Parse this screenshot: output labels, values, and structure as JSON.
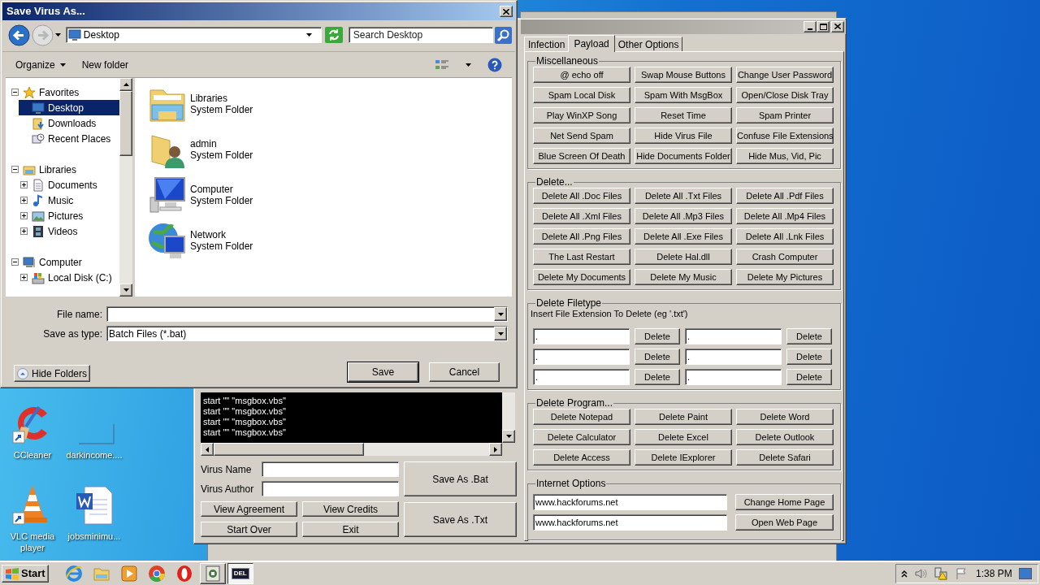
{
  "dialog": {
    "title": "Save Virus As...",
    "address": "Desktop",
    "search_placeholder": "Search Desktop",
    "organize": "Organize",
    "new_folder": "New folder",
    "nav": [
      {
        "label": "Favorites",
        "expanded": true,
        "selected": false,
        "children": [
          {
            "label": "Desktop",
            "selected": true
          },
          {
            "label": "Downloads",
            "selected": false
          },
          {
            "label": "Recent Places",
            "selected": false
          }
        ]
      },
      {
        "label": "Libraries",
        "expanded": true,
        "selected": false,
        "children": [
          {
            "label": "Documents",
            "expanded": false,
            "selected": false
          },
          {
            "label": "Music",
            "expanded": false,
            "selected": false
          },
          {
            "label": "Pictures",
            "expanded": false,
            "selected": false
          },
          {
            "label": "Videos",
            "expanded": false,
            "selected": false
          }
        ]
      },
      {
        "label": "Computer",
        "expanded": true,
        "selected": false,
        "children": [
          {
            "label": "Local Disk (C:)",
            "expanded": false,
            "selected": false
          }
        ]
      }
    ],
    "items": [
      {
        "name": "Libraries",
        "type": "System Folder"
      },
      {
        "name": "admin",
        "type": "System Folder"
      },
      {
        "name": "Computer",
        "type": "System Folder"
      },
      {
        "name": "Network",
        "type": "System Folder"
      }
    ],
    "file_name_label": "File name:",
    "save_type_label": "Save as type:",
    "save_type": "Batch Files (*.bat)",
    "hide_folders": "Hide Folders",
    "save": "Save",
    "cancel": "Cancel"
  },
  "app": {
    "tabs": [
      {
        "label": "Infection",
        "selected": false
      },
      {
        "label": "Payload",
        "selected": true
      },
      {
        "label": "Other Options",
        "selected": false
      }
    ],
    "sections": [
      {
        "kind": "buttons",
        "title": "Miscellaneous",
        "buttons": [
          "@ echo off",
          "Swap Mouse Buttons",
          "Change User Password",
          "Spam Local Disk",
          "Spam With MsgBox",
          "Open/Close Disk Tray",
          "Play WinXP Song",
          "Reset Time",
          "Spam Printer",
          "Net Send Spam",
          "Hide Virus File",
          "Confuse File Extensions",
          "Blue Screen Of Death",
          "Hide Documents Folder",
          "Hide Mus, Vid, Pic"
        ]
      },
      {
        "kind": "buttons",
        "title": "Delete...",
        "buttons": [
          "Delete All .Doc Files",
          "Delete All .Txt Files",
          "Delete All .Pdf Files",
          "Delete All .Xml Files",
          "Delete All .Mp3 Files",
          "Delete All .Mp4 Files",
          "Delete All .Png Files",
          "Delete All .Exe Files",
          "Delete All .Lnk Files",
          "The Last Restart",
          "Delete Hal.dll",
          "Crash Computer",
          "Delete My Documents",
          "Delete My Music",
          "Delete My Pictures"
        ]
      },
      {
        "kind": "filetype",
        "title": "Delete Filetype",
        "hint": "Insert File Extension To Delete (eg '.txt')",
        "rows": [
          {
            "value": ".",
            "button": "Delete"
          },
          {
            "value": ".",
            "button": "Delete"
          },
          {
            "value": ".",
            "button": "Delete"
          },
          {
            "value": ".",
            "button": "Delete"
          },
          {
            "value": ".",
            "button": "Delete"
          },
          {
            "value": ".",
            "button": "Delete"
          }
        ]
      },
      {
        "kind": "buttons",
        "title": "Delete Program...",
        "buttons": [
          "Delete Notepad",
          "Delete Paint",
          "Delete Word",
          "Delete Calculator",
          "Delete Excel",
          "Delete Outlook",
          "Delete Access",
          "Delete IExplorer",
          "Delete Safari"
        ]
      },
      {
        "kind": "urls",
        "title": "Internet Options",
        "rows": [
          {
            "value": "www.hackforums.net",
            "button": "Change Home Page"
          },
          {
            "value": "www.hackforums.net",
            "button": "Open Web Page"
          }
        ]
      }
    ],
    "script_lines": [
      "start \"\" \"msgbox.vbs\"",
      "start \"\" \"msgbox.vbs\"",
      "start \"\" \"msgbox.vbs\"",
      "start \"\" \"msgbox.vbs\""
    ],
    "fields": [
      "Virus Name",
      "Virus Author"
    ],
    "buttons": [
      "View Agreement",
      "View Credits",
      "Start Over",
      "Exit"
    ],
    "save_buttons": [
      "Save As .Bat",
      "Save As .Txt"
    ]
  },
  "desktop_icons": [
    {
      "label": "CCleaner"
    },
    {
      "label": "darkincome...."
    },
    {
      "label": "VLC media player"
    },
    {
      "label": "jobsminimu..."
    }
  ],
  "taskbar": {
    "start": "Start",
    "apps": [
      {
        "kind": "pinned",
        "selected": false
      },
      {
        "kind": "pinned",
        "selected": false
      },
      {
        "kind": "pinned",
        "selected": false
      },
      {
        "kind": "pinned",
        "selected": false
      },
      {
        "kind": "pinned",
        "selected": false
      },
      {
        "kind": "window",
        "selected": false
      },
      {
        "kind": "window",
        "selected": true,
        "label": "DEL"
      }
    ],
    "clock": "1:38 PM"
  }
}
